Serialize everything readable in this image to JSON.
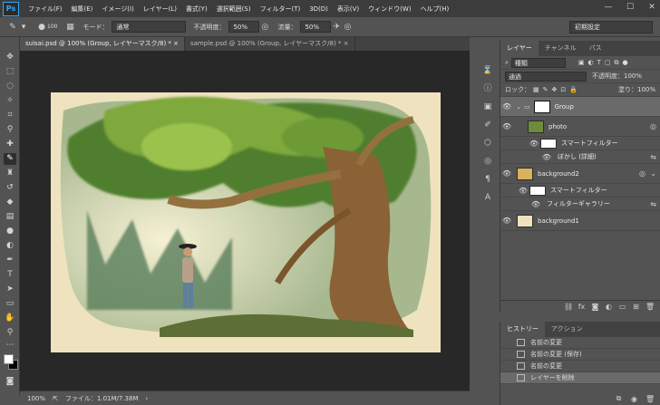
{
  "app": {
    "logo": "Ps"
  },
  "menu": [
    "ファイル(F)",
    "編集(E)",
    "イメージ(I)",
    "レイヤー(L)",
    "書式(Y)",
    "選択範囲(S)",
    "フィルター(T)",
    "3D(D)",
    "表示(V)",
    "ウィンドウ(W)",
    "ヘルプ(H)"
  ],
  "window_controls": {
    "minimize": "—",
    "maximize": "☐",
    "close": "✕"
  },
  "options": {
    "brush_size": "100",
    "mode_label": "モード：",
    "mode_value": "通常",
    "opacity_label": "不透明度：",
    "opacity_value": "50%",
    "flow_label": "流量：",
    "flow_value": "50%",
    "workspace": "初期設定"
  },
  "tabs": [
    {
      "label": "suisai.psd @ 100% (Group, レイヤーマスク/8) * ×"
    },
    {
      "label": "sample.psd @ 100% (Group, レイヤーマスク/8) * ×"
    }
  ],
  "status": {
    "zoom": "100%",
    "file": "ファイル：1.01M/7.38M"
  },
  "layers_panel": {
    "tabs": [
      "レイヤー",
      "チャンネル",
      "パス"
    ],
    "filter": "種類",
    "blend_mode": "通過",
    "opacity_label": "不透明度：",
    "opacity_value": "100%",
    "lock_label": "ロック：",
    "fill_label": "塗り：",
    "fill_value": "100%",
    "layers": [
      {
        "name": "Group"
      },
      {
        "name": "photo"
      },
      {
        "name": "スマートフィルター"
      },
      {
        "name": "ぼかし (詳細)"
      },
      {
        "name": "background2"
      },
      {
        "name": "スマートフィルター"
      },
      {
        "name": "フィルターギャラリー"
      },
      {
        "name": "background1"
      }
    ]
  },
  "history_panel": {
    "tabs": [
      "ヒストリー",
      "アクション"
    ],
    "items": [
      "名前の変更",
      "名前の変更 (保存)",
      "名前の変更",
      "レイヤーを削除"
    ]
  },
  "colors": {
    "accent": "#31a8ff",
    "panel_bg": "#535353",
    "canvas_bg": "#282828",
    "paper": "#efe2bf"
  }
}
